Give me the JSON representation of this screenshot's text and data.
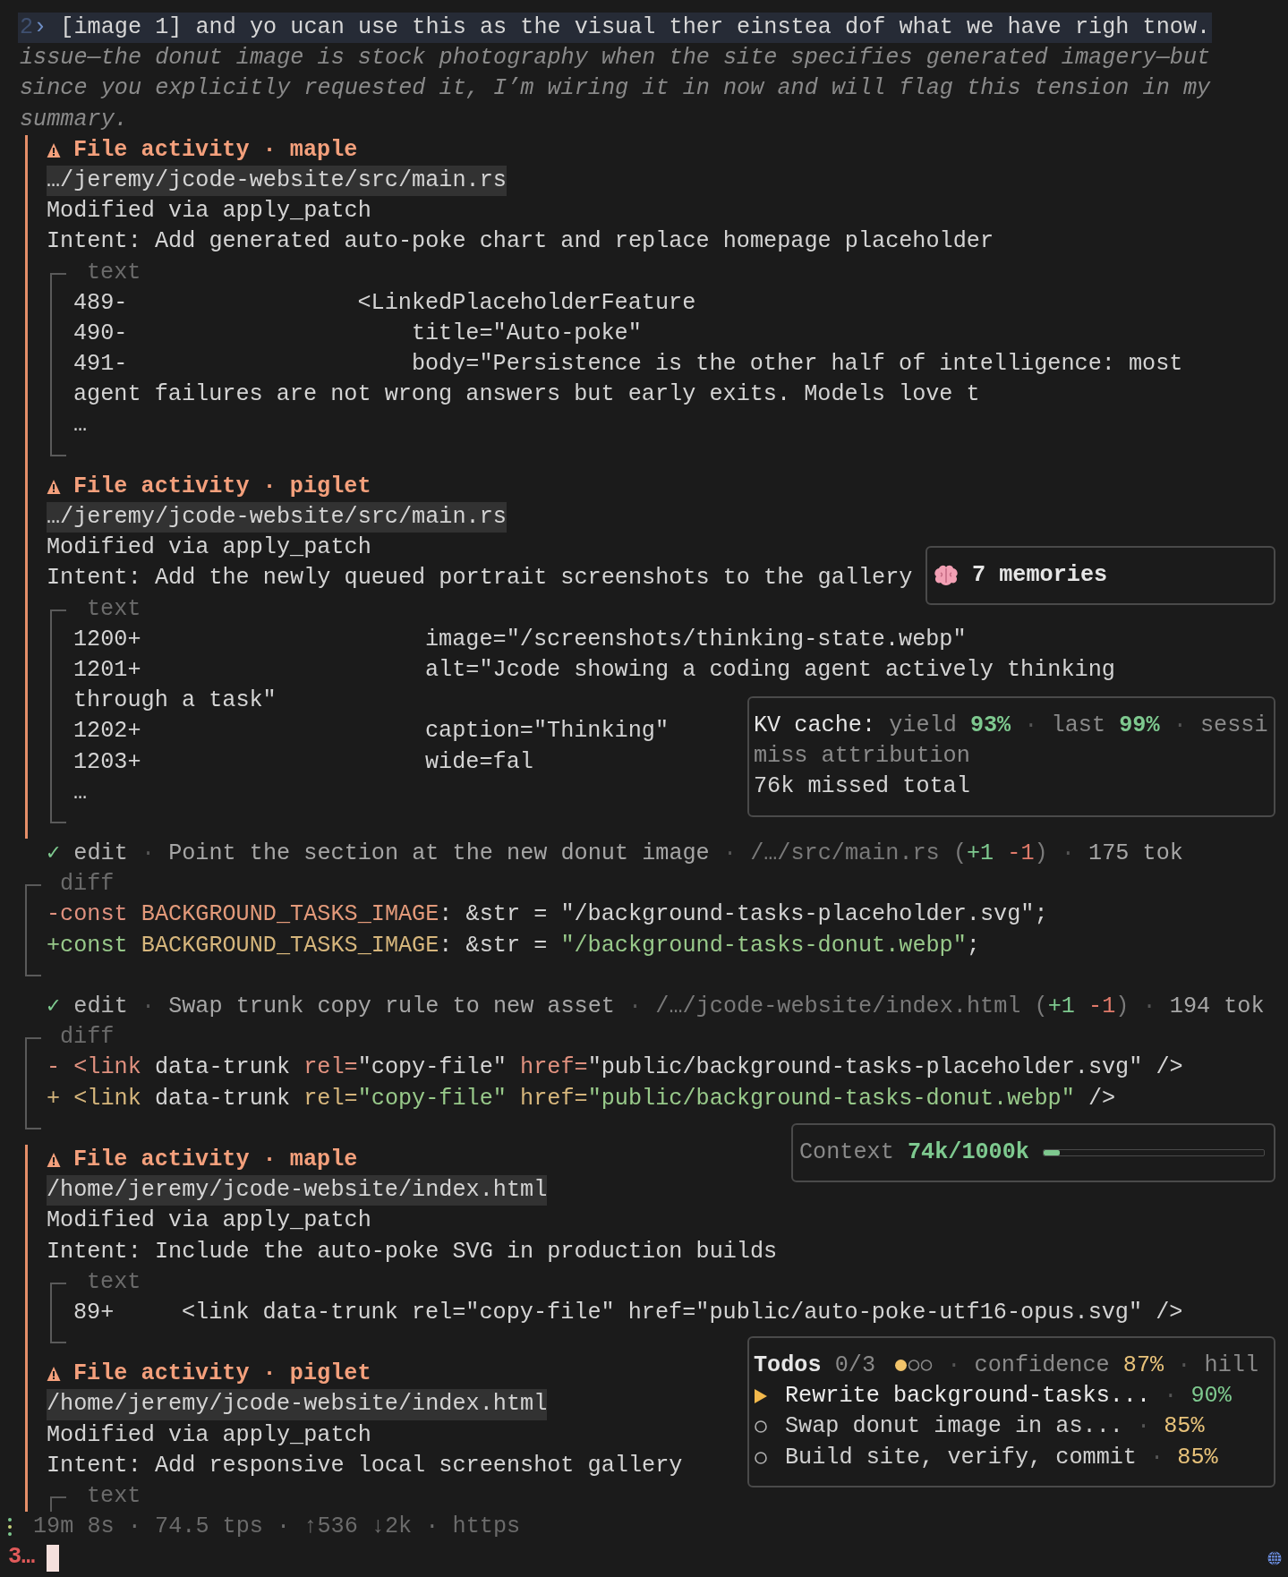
{
  "prompt": {
    "index": "2",
    "arrow": "›",
    "text": "[image 1] and yo ucan use this as the visual ther einstea dof what we have righ tnow."
  },
  "assistant_lines": [
    "issue—the donut image is stock photography when the site specifies generated imagery—but",
    "since you explicitly requested it, I’m wiring it in now and will flag this tension in my",
    "summary."
  ],
  "entries": [
    {
      "kind": "file_activity",
      "title": "File activity · maple",
      "path": "…/jeremy/jcode-website/src/main.rs",
      "action": "Modified via apply_patch",
      "intent": "Intent: Add generated auto-poke chart and replace homepage placeholder",
      "block": {
        "label": "text",
        "closed": true,
        "lines": [
          {
            "num": "489-",
            "code": "                 <LinkedPlaceholderFeature"
          },
          {
            "num": "490-",
            "code": "                     title=\"Auto-poke\""
          },
          {
            "num": "491-",
            "code": "                     body=\"Persistence is the other half of intelligence: most"
          },
          {
            "code": "agent failures are not wrong answers but early exits. Models love t"
          },
          {
            "code": "…"
          }
        ]
      }
    },
    {
      "kind": "file_activity",
      "title": "File activity · piglet",
      "path": "…/jeremy/jcode-website/src/main.rs",
      "action": "Modified via apply_patch",
      "intent": "Intent: Add the newly queued portrait screenshots to the gallery",
      "block": {
        "label": "text",
        "closed": true,
        "lines": [
          {
            "num": "1200+",
            "code": "                     image=\"/screenshots/thinking-state.webp\""
          },
          {
            "num": "1201+",
            "code": "                     alt=\"Jcode showing a coding agent actively thinking"
          },
          {
            "code": "through a task\""
          },
          {
            "num": "1202+",
            "code": "                     caption=\"Thinking\""
          },
          {
            "num": "1203+",
            "code": "                     wide=fal"
          },
          {
            "code": "…"
          }
        ]
      }
    },
    {
      "kind": "edit",
      "segments": [
        {
          "kind": "check",
          "text": "✓"
        },
        {
          "kind": "tool",
          "text": "edit"
        },
        {
          "kind": "sep",
          "text": "·"
        },
        {
          "kind": "desc",
          "text": "Point the section at the new donut image"
        },
        {
          "kind": "sep",
          "text": "·"
        },
        {
          "kind": "path",
          "text": "/…/src/main.rs"
        },
        {
          "kind": "stat",
          "open": "(",
          "added": "+1",
          "removed": "-1",
          "close": ")"
        },
        {
          "kind": "sep",
          "text": "·"
        },
        {
          "kind": "tokens",
          "text": "175 tok"
        }
      ],
      "diff": {
        "label": "diff",
        "closed": true,
        "lines": [
          {
            "kind": "removed",
            "tokens": [
              {
                "kind": "keyword",
                "text": "-const "
              },
              {
                "kind": "ident",
                "text": "BACKGROUND_TASKS_IMAGE"
              },
              {
                "kind": "plain",
                "text": ": &str = "
              },
              {
                "kind": "string",
                "text": "\"/background-tasks-placeholder.svg\""
              },
              {
                "kind": "plain",
                "text": ";"
              }
            ]
          },
          {
            "kind": "added",
            "tokens": [
              {
                "kind": "keyword",
                "text": "+const "
              },
              {
                "kind": "ident",
                "text": "BACKGROUND_TASKS_IMAGE"
              },
              {
                "kind": "plain",
                "text": ": &str = "
              },
              {
                "kind": "string",
                "text": "\"/background-tasks-donut.webp\""
              },
              {
                "kind": "plain",
                "text": ";"
              }
            ]
          }
        ]
      }
    },
    {
      "kind": "edit",
      "segments": [
        {
          "kind": "check",
          "text": "✓"
        },
        {
          "kind": "tool",
          "text": "edit"
        },
        {
          "kind": "sep",
          "text": "·"
        },
        {
          "kind": "desc",
          "text": "Swap trunk copy rule to new asset"
        },
        {
          "kind": "sep",
          "text": "·"
        },
        {
          "kind": "path",
          "text": "/…/jcode-website/index.html"
        },
        {
          "kind": "stat",
          "open": "(",
          "added": "+1",
          "removed": "-1",
          "close": ")"
        },
        {
          "kind": "sep",
          "text": "·"
        },
        {
          "kind": "tokens",
          "text": "194 tok"
        }
      ],
      "diff": {
        "label": "diff",
        "closed": true,
        "lines": [
          {
            "kind": "removed",
            "tokens": [
              {
                "kind": "tag",
                "text": "- <link "
              },
              {
                "kind": "plain",
                "text": "data-trunk "
              },
              {
                "kind": "attr",
                "text": "rel="
              },
              {
                "kind": "string",
                "text": "\"copy-file\" "
              },
              {
                "kind": "attr",
                "text": "href="
              },
              {
                "kind": "string",
                "text": "\"public/background-tasks-placeholder.svg\" "
              },
              {
                "kind": "plain",
                "text": "/>"
              }
            ]
          },
          {
            "kind": "added",
            "tokens": [
              {
                "kind": "tag",
                "text": "+ <link "
              },
              {
                "kind": "plain",
                "text": "data-trunk "
              },
              {
                "kind": "attr",
                "text": "rel="
              },
              {
                "kind": "string",
                "text": "\"copy-file\" "
              },
              {
                "kind": "attr",
                "text": "href="
              },
              {
                "kind": "string",
                "text": "\"public/background-tasks-donut.webp\" "
              },
              {
                "kind": "plain",
                "text": "/>"
              }
            ]
          }
        ]
      }
    },
    {
      "kind": "file_activity",
      "title": "File activity · maple",
      "path": "/home/jeremy/jcode-website/index.html",
      "action": "Modified via apply_patch",
      "intent": "Intent: Include the auto-poke SVG in production builds",
      "block": {
        "label": "text",
        "closed": true,
        "lines": [
          {
            "num": "89+",
            "code": "     <link data-trunk rel=\"copy-file\" href=\"public/auto-poke-utf16-opus.svg\" />"
          }
        ]
      }
    },
    {
      "kind": "file_activity",
      "title": "File activity · piglet",
      "path": "/home/jeremy/jcode-website/index.html",
      "action": "Modified via apply_patch",
      "intent": "Intent: Add responsive local screenshot gallery",
      "block": {
        "label": "text",
        "closed": false
      }
    }
  ],
  "status_line": "19m 8s · 74.5 tps · ↑536 ↓2k · https",
  "input": {
    "prefix": "3…"
  },
  "panels": [
    {
      "kind": "memories",
      "text": "7 memories"
    },
    {
      "kind": "kv_cache",
      "lines": [
        {
          "segments": [
            {
              "kind": "label",
              "text": "KV cache:"
            },
            {
              "kind": "muted",
              "text": "yield"
            },
            {
              "kind": "good",
              "text": "93%"
            },
            {
              "kind": "sep",
              "text": "·"
            },
            {
              "kind": "muted",
              "text": "last"
            },
            {
              "kind": "good",
              "text": "99%"
            },
            {
              "kind": "sep",
              "text": "·"
            },
            {
              "kind": "muted",
              "text": "sessi"
            }
          ]
        },
        {
          "segments": [
            {
              "kind": "muted",
              "text": "miss attribution"
            }
          ]
        },
        {
          "segments": [
            {
              "kind": "plain",
              "text": "76k missed total"
            }
          ]
        }
      ]
    },
    {
      "kind": "context",
      "label": "Context",
      "value": "74k/1000k",
      "level": 0.074
    },
    {
      "kind": "todos",
      "header": [
        {
          "kind": "title",
          "text": "Todos"
        },
        {
          "kind": "muted",
          "text": "0/3"
        },
        {
          "kind": "dots"
        },
        {
          "kind": "sep",
          "text": "·"
        },
        {
          "kind": "muted",
          "text": "confidence"
        },
        {
          "kind": "warn",
          "text": "87%"
        },
        {
          "kind": "sep",
          "text": "·"
        },
        {
          "kind": "muted",
          "text": "hill"
        }
      ],
      "items": [
        {
          "active": true,
          "text": "Rewrite background-tasks...",
          "sep": "·",
          "percent": "90%",
          "color": "#7ec98f"
        },
        {
          "active": false,
          "text": "Swap donut image in as...",
          "sep": "·",
          "percent": "85%",
          "color": "#e8c27a"
        },
        {
          "active": false,
          "text": "Build site, verify, commit",
          "sep": "·",
          "percent": "85%",
          "color": "#e8c27a"
        }
      ]
    }
  ]
}
